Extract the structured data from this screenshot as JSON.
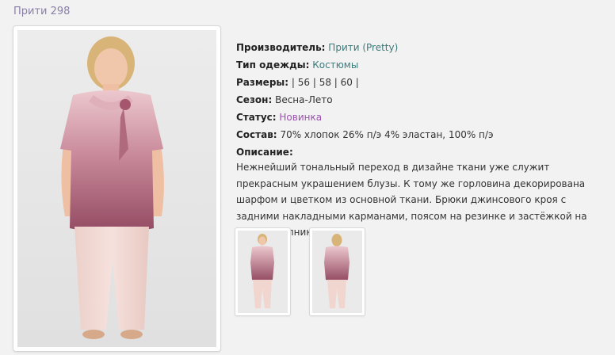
{
  "product": {
    "title": "Прити 298"
  },
  "details": {
    "manufacturer_label": "Производитель:",
    "manufacturer_value": "Прити (Pretty)",
    "type_label": "Тип одежды:",
    "type_value": "Костюмы",
    "sizes_label": "Размеры:",
    "sizes_value": "| 56 | 58 | 60 |",
    "season_label": "Сезон:",
    "season_value": "Весна-Лето",
    "status_label": "Статус:",
    "status_value": "Новинка",
    "composition_label": "Состав:",
    "composition_value": "70% хлопок 26% п/э 4% эластан, 100% п/э",
    "description_label": "Описание:",
    "description_text": "Нежнейший тональный переход в дизайне ткани уже служит прекрасным украшением блузы. К тому же горловина декорирована шарфом и цветком из основной ткани. Брюки джинсового кроя с задними накладными карманами, поясом на резинке и застёжкой на тесьму-молнию."
  },
  "colors": {
    "link": "#3d7a7a",
    "status": "#9b4fb0",
    "title": "#8a7fa6",
    "blouse_top": "#e6bcc4",
    "blouse_bottom": "#9a4f67",
    "pants": "#f1d6d0"
  }
}
